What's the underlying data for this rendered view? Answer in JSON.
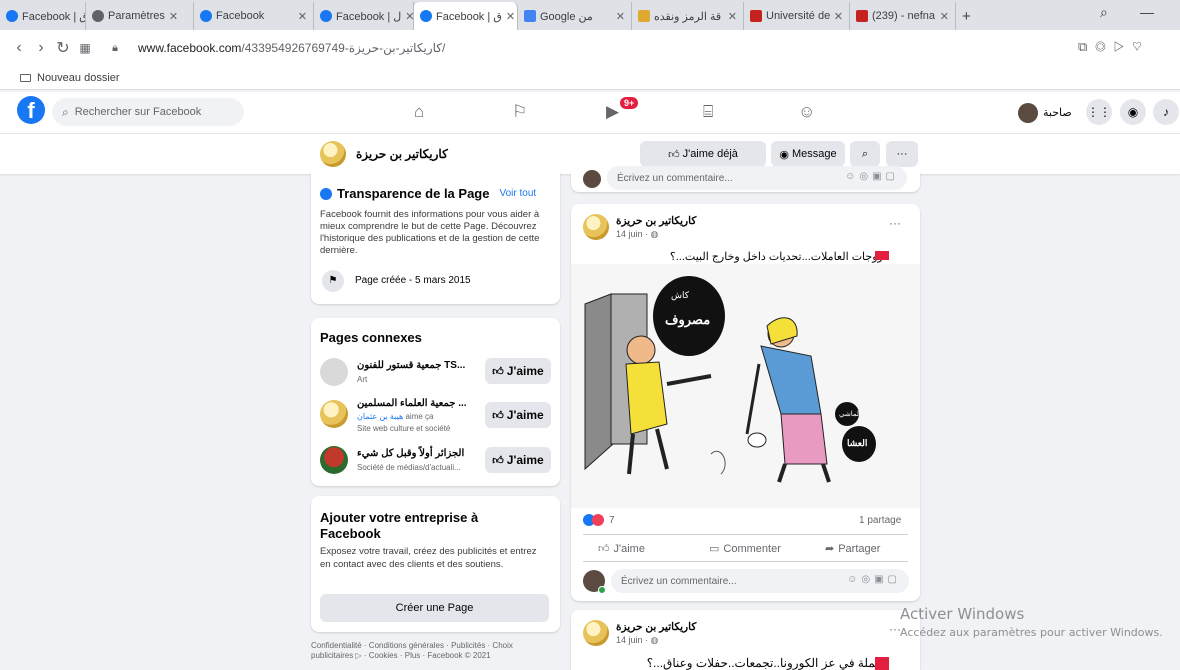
{
  "browser": {
    "tabs": [
      {
        "label": "Facebook | ق"
      },
      {
        "label": "Paramètres"
      },
      {
        "label": "Facebook"
      },
      {
        "label": "Facebook | ل"
      },
      {
        "label": "Facebook | ق"
      },
      {
        "label": "Google من"
      },
      {
        "label": "قة الرمز ونقده"
      },
      {
        "label": "Université de"
      },
      {
        "label": "(239) - nefna"
      }
    ],
    "url_domain": "www.facebook.com",
    "url_path": "/433954926769749-كاريكاتير-بن-حريزة/",
    "bookmark": "Nouveau dossier"
  },
  "fb_header": {
    "search_placeholder": "Rechercher sur Facebook",
    "video_badge": "9+",
    "username": "صاحبة"
  },
  "page_bar": {
    "page_name": "كاريكاتير بن حريزة",
    "like_label": "J'aime déjà",
    "message_label": "Message"
  },
  "transparency": {
    "title": "Transparence de la Page",
    "see_all": "Voir tout",
    "text": "Facebook fournit des informations pour vous aider à mieux comprendre le but de cette Page. Découvrez l'historique des publications et de la gestion de cette dernière.",
    "created": "Page créée - 5 mars 2015"
  },
  "related": {
    "title": "Pages connexes",
    "like_label": "J'aime",
    "items": [
      {
        "name": "جمعية قستور للفنون TS...",
        "line1": "Art",
        "line1_link": "",
        "line2": ""
      },
      {
        "name": "جمعية العلماء المسلمين ...",
        "line1": "aime ça",
        "line1_link": "هيبة بن عثمان",
        "line2": "Site web culture et société"
      },
      {
        "name": "الجزائر أولاً وقبل كل شيء",
        "line1": "Société de médias/d'actuali...",
        "line1_link": "",
        "line2": ""
      }
    ]
  },
  "business": {
    "title": "Ajouter votre entreprise à Facebook",
    "text": "Exposez votre travail, créez des publicités et entrez en contact avec des clients et des soutiens.",
    "button": "Créer une Page"
  },
  "footer": {
    "text": "Confidentialité · Conditions générales · Publicités · Choix publicitaires ▷ · Cookies · Plus · Facebook © 2021"
  },
  "feed": {
    "comment_placeholder": "Écrivez un commentaire...",
    "post1": {
      "author": "كاريكاتير بن حريزة",
      "date": "14 juin · ",
      "caption": "الزوجات العاملات...تحديات داخل وخارج البيت...؟",
      "bubble1": "كاش",
      "bubble2": "مصروف",
      "bubble3": "العشا",
      "bubble4": "لماشي",
      "reactions_count": "7",
      "shares": "1 partage",
      "like": "J'aime",
      "comment": "Commenter",
      "share": "Partager"
    },
    "post2": {
      "author": "كاريكاتير بن حريزة",
      "date": "14 juin · ",
      "caption": "الحملة في عز الكورونا..تجمعات..حفلات وعناق...؟"
    }
  },
  "watermark": {
    "title": "Activer Windows",
    "subtitle": "Accédez aux paramètres pour activer Windows."
  },
  "colors": {
    "fb_blue": "#1877f2",
    "bg": "#f0f2f5",
    "badge_red": "#e41e3f"
  }
}
